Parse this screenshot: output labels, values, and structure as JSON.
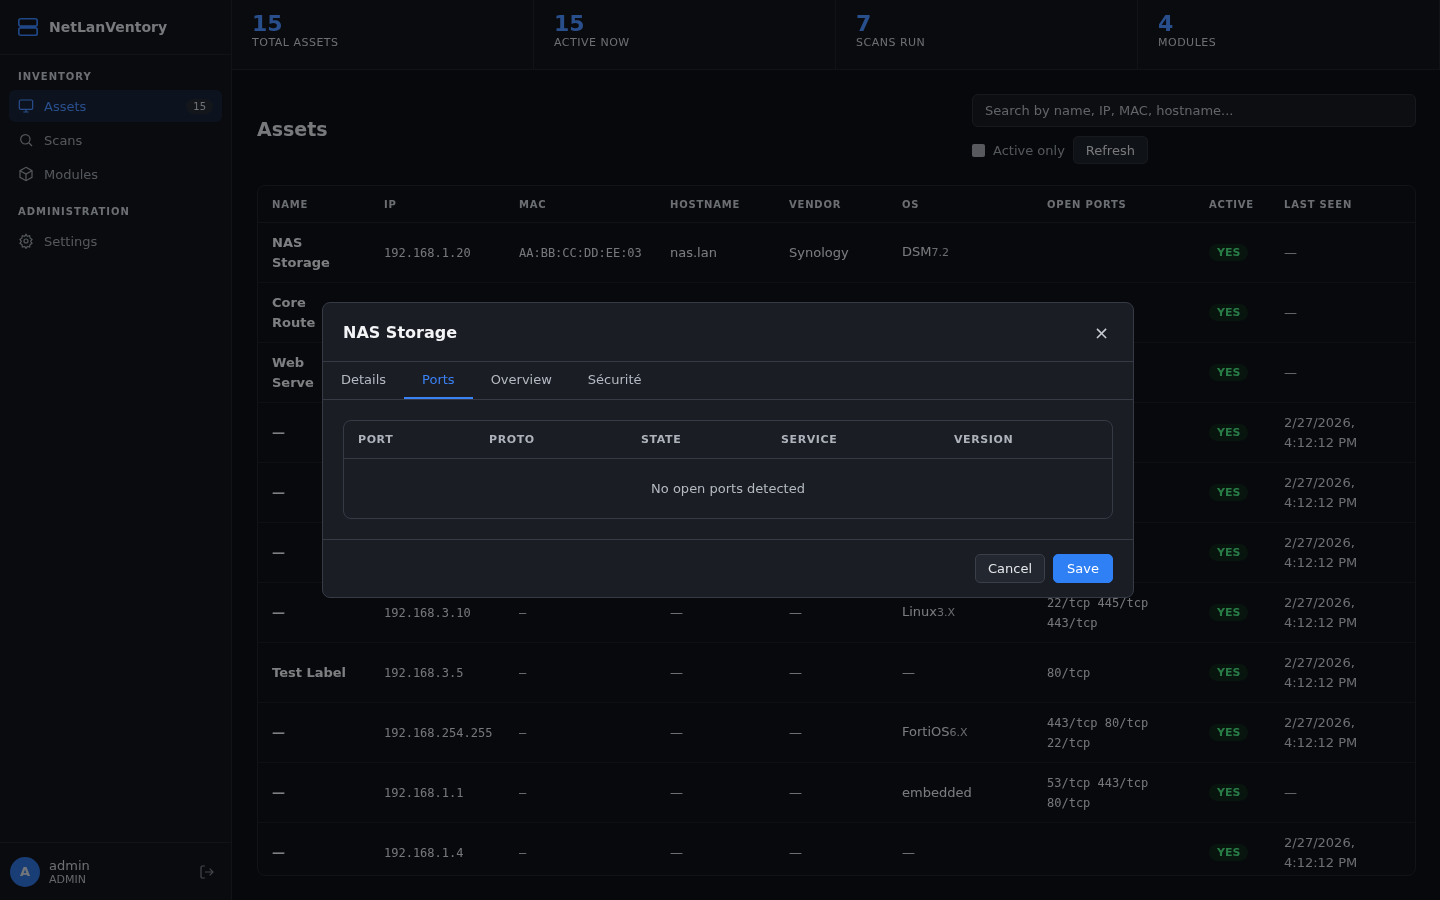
{
  "sidebar": {
    "brand": "NetLanVentory",
    "sections": [
      {
        "title": "INVENTORY",
        "items": [
          {
            "label": "Assets",
            "count": "15",
            "selected": true
          },
          {
            "label": "Scans",
            "selected": false
          },
          {
            "label": "Modules",
            "selected": false
          }
        ]
      },
      {
        "title": "ADMINISTRATION",
        "items": [
          {
            "label": "Settings",
            "selected": false
          }
        ]
      }
    ],
    "user": {
      "initial": "A",
      "name": "admin",
      "role": "ADMIN"
    }
  },
  "stats": [
    {
      "value": "15",
      "label": "TOTAL ASSETS"
    },
    {
      "value": "15",
      "label": "ACTIVE NOW"
    },
    {
      "value": "7",
      "label": "SCANS RUN"
    },
    {
      "value": "4",
      "label": "MODULES"
    }
  ],
  "page": {
    "title": "Assets",
    "search": {
      "placeholder": "Search by name, IP, MAC, hostname..."
    },
    "active_only": {
      "label": "Active only",
      "checked": false
    },
    "refresh": "Refresh"
  },
  "table": {
    "columns": [
      "NAME",
      "IP",
      "MAC",
      "HOSTNAME",
      "VENDOR",
      "OS",
      "OPEN PORTS",
      "ACTIVE",
      "LAST SEEN"
    ],
    "rows": [
      {
        "name": "NAS Storage",
        "ip": "192.168.1.20",
        "mac": "AA:BB:CC:DD:EE:03",
        "hostname": "nas.lan",
        "vendor": "Synology",
        "os": "DSM",
        "os_version": "7.2",
        "active": "YES",
        "last_seen": "—"
      },
      {
        "name": "Core Route",
        "active": "YES",
        "last_seen": "—"
      },
      {
        "name": "Web Serve",
        "active": "YES",
        "last_seen": "—"
      },
      {
        "name": "—",
        "active": "YES",
        "last_seen": "2/27/2026, 4:12:12 PM"
      },
      {
        "name": "—",
        "active": "YES",
        "last_seen": "2/27/2026, 4:12:12 PM"
      },
      {
        "name": "—",
        "active": "YES",
        "last_seen": "2/27/2026, 4:12:12 PM"
      },
      {
        "name": "—",
        "ip": "192.168.3.10",
        "mac": "–",
        "hostname": "—",
        "vendor": "—",
        "os": "Linux",
        "os_version": "3.X",
        "ports": "22/tcp 445/tcp 443/tcp",
        "active": "YES",
        "last_seen": "2/27/2026, 4:12:12 PM"
      },
      {
        "name": "Test Label",
        "ip": "192.168.3.5",
        "mac": "–",
        "hostname": "—",
        "vendor": "—",
        "os": "—",
        "ports": "80/tcp",
        "active": "YES",
        "last_seen": "2/27/2026, 4:12:12 PM"
      },
      {
        "name": "—",
        "ip": "192.168.254.255",
        "mac": "–",
        "hostname": "—",
        "vendor": "—",
        "os": "FortiOS",
        "os_version": "6.X",
        "ports": "443/tcp 80/tcp 22/tcp",
        "active": "YES",
        "last_seen": "2/27/2026, 4:12:12 PM"
      },
      {
        "name": "—",
        "ip": "192.168.1.1",
        "mac": "–",
        "hostname": "—",
        "vendor": "—",
        "os": "embedded",
        "ports": "53/tcp 443/tcp 80/tcp",
        "active": "YES",
        "last_seen": "—"
      },
      {
        "name": "—",
        "ip": "192.168.1.4",
        "mac": "–",
        "hostname": "—",
        "vendor": "—",
        "os": "—",
        "active": "YES",
        "last_seen": "2/27/2026, 4:12:12 PM"
      }
    ]
  },
  "modal": {
    "title": "NAS Storage",
    "close": "×",
    "tabs": [
      {
        "label": "Details",
        "selected": false
      },
      {
        "label": "Ports",
        "selected": true
      },
      {
        "label": "Overview",
        "selected": false
      },
      {
        "label": "Sécurité",
        "selected": false
      }
    ],
    "ports_table": {
      "columns": [
        "PORT",
        "PROTO",
        "STATE",
        "SERVICE",
        "VERSION"
      ],
      "empty": "No open ports detected"
    },
    "buttons": [
      {
        "label": "Cancel",
        "kind": "secondary"
      },
      {
        "label": "Save",
        "kind": "primary"
      }
    ]
  }
}
